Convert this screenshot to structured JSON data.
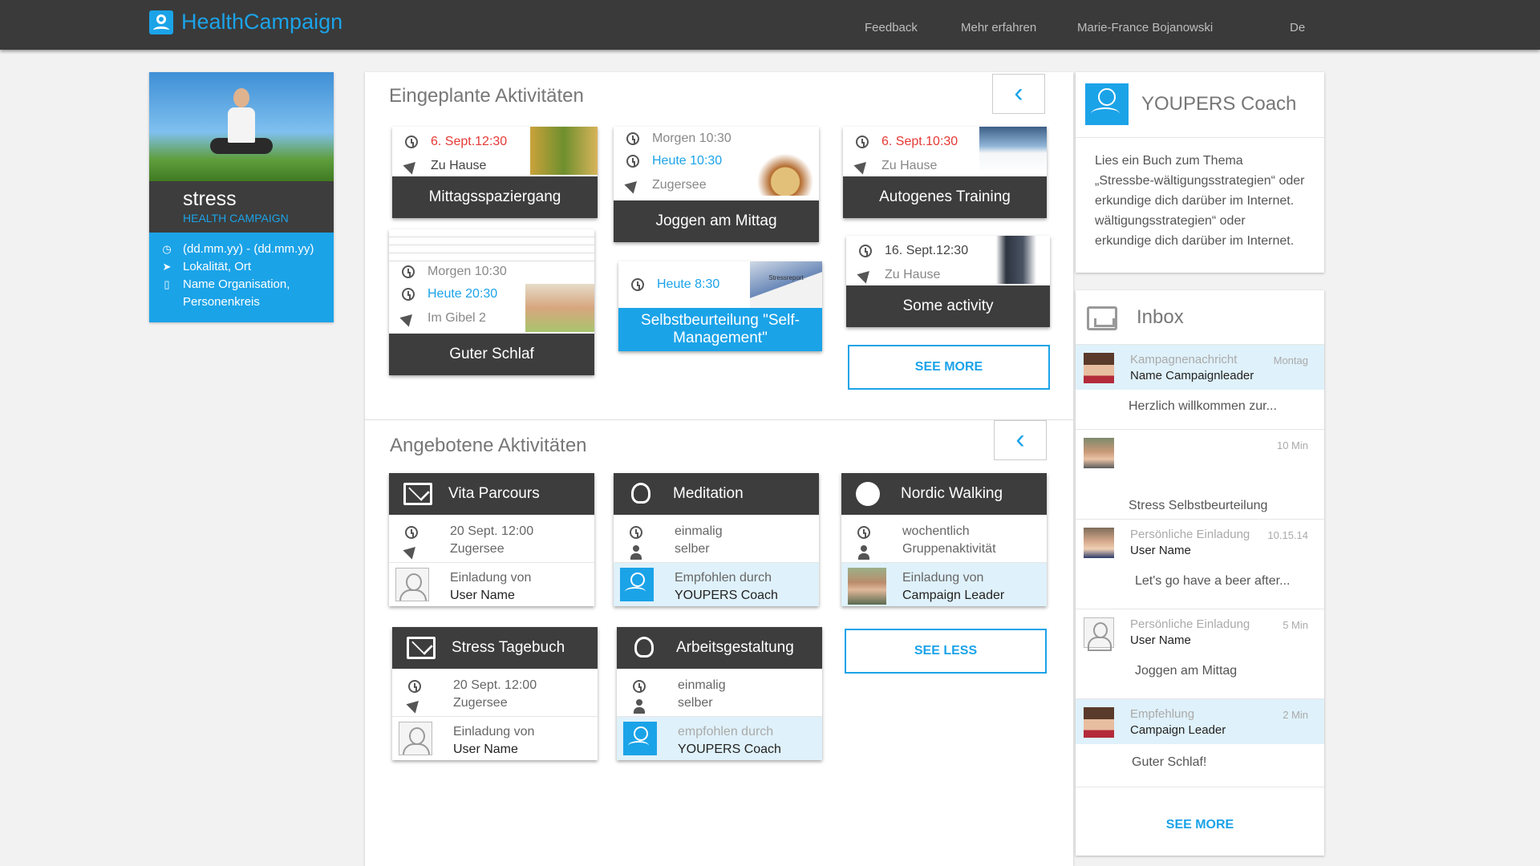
{
  "topbar": {
    "app_name": "HealthCampaign",
    "nav": [
      "Feedback",
      "Mehr erfahren",
      "Marie-France Bojanowski",
      "De"
    ]
  },
  "campaign": {
    "title": "stress",
    "subtitle": "HEALTH CAMPAIGN",
    "details": [
      "(dd.mm.yy) - (dd.mm.yy)",
      "Lokalität, Ort",
      "Name Organisation, Personenkreis"
    ]
  },
  "scheduled": {
    "title": "Eingeplante Aktivitäten",
    "back_icon": "chevron-left-icon",
    "cards": [
      {
        "time": "6. Sept.12:30",
        "time_color": "red",
        "place": "Zu Hause",
        "name": "Mittagsspaziergang"
      },
      {
        "time_prev": "Morgen 10:30",
        "time": "Heute 10:30",
        "time_color": "blue",
        "place": "Zugersee",
        "name": "Joggen am Mittag"
      },
      {
        "time": "6. Sept.10:30",
        "time_color": "red",
        "place": "Zu Hause",
        "name": "Autogenes Training"
      },
      {
        "time_prev": "Morgen 10:30",
        "time": "Heute 20:30",
        "time_color": "blue",
        "place": "Im Gibel 2",
        "name": "Guter Schlaf"
      },
      {
        "time": "Heute 8:30",
        "time_color": "blue",
        "place": "",
        "name": "Selbstbeurteilung \"Self- Management\"",
        "thumb_text": "Stressreport"
      },
      {
        "time": "16. Sept.12:30",
        "time_color": "dark",
        "place": "Zu Hause",
        "name": "Some activity"
      }
    ],
    "see_more": "SEE MORE"
  },
  "offered": {
    "title": "Angebotene Aktivitäten",
    "back_icon": "chevron-left-icon",
    "cards": [
      {
        "name": "Vita Parcours",
        "icon": "envelope-icon",
        "line1": "20 Sept. 12:00",
        "line2": "Zugersee",
        "foot_label": "Einladung von",
        "foot_name": "User Name"
      },
      {
        "name": "Meditation",
        "icon": "lightbulb-icon",
        "line1": "einmalig",
        "line2": "selber",
        "foot_label": "Empfohlen durch",
        "foot_name": "YOUPERS Coach"
      },
      {
        "name": "Nordic Walking",
        "icon": "globe-icon",
        "line1": "wochentlich",
        "line2": "Gruppenaktivität",
        "foot_label": "Einladung von",
        "foot_name": "Campaign Leader"
      },
      {
        "name": "Stress Tagebuch",
        "icon": "envelope-icon",
        "line1": "20 Sept. 12:00",
        "line2": "Zugersee",
        "foot_label": "Einladung von",
        "foot_name": "User Name"
      },
      {
        "name": "Arbeitsgestaltung",
        "icon": "lightbulb-icon",
        "line1": "einmalig",
        "line2": "selber",
        "foot_label": "empfohlen durch",
        "foot_name": "YOUPERS Coach"
      }
    ],
    "see_less": "SEE LESS"
  },
  "coach": {
    "title": "YOUPERS Coach",
    "text": "Lies ein Buch zum Thema „Stressbe-wältigungsstrategien“ oder erkundige dich darüber im Internet. wältigungsstrategien“ oder erkundige dich darüber im Internet."
  },
  "inbox": {
    "title": "Inbox",
    "messages": [
      {
        "kind": "Kampagnenachricht",
        "name": "Name Campaignleader",
        "time": "Montag",
        "body": "Herzlich willkommen zur..."
      },
      {
        "kind": "",
        "name": "",
        "time": "10 Min",
        "body": "Stress Selbstbeurteilung"
      },
      {
        "kind": "Persönliche Einladung",
        "name": "User Name",
        "time": "10.15.14",
        "body": "Let's go have a beer after..."
      },
      {
        "kind": "Persönliche Einladung",
        "name": "User Name",
        "time": "5 Min",
        "body": "Joggen am Mittag"
      },
      {
        "kind": "Empfehlung",
        "name": "Campaign Leader",
        "time": "2 Min",
        "body": "Guter Schlaf!"
      }
    ],
    "see_more": "SEE MORE"
  },
  "colors": {
    "accent": "#1ba3e8",
    "topbar": "#3a3a3a",
    "card_bar": "#3d3d3d",
    "highlight": "#dff1fa",
    "red": "#e53935"
  }
}
